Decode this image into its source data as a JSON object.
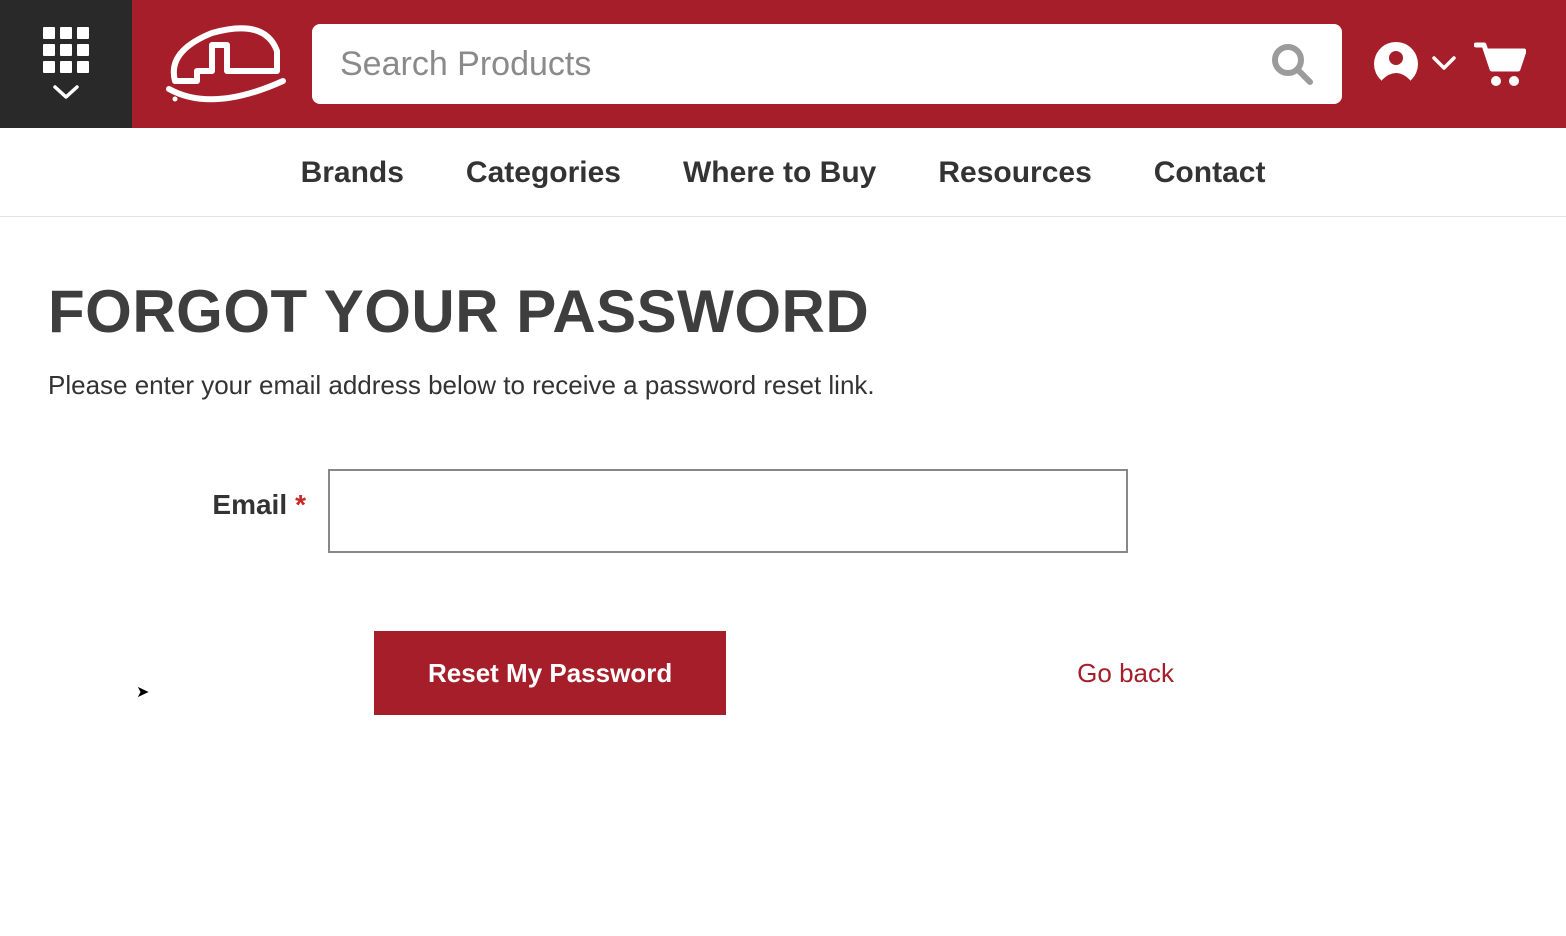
{
  "header": {
    "search_placeholder": "Search Products"
  },
  "nav": {
    "items": [
      "Brands",
      "Categories",
      "Where to Buy",
      "Resources",
      "Contact"
    ]
  },
  "page": {
    "title": "FORGOT YOUR PASSWORD",
    "subtitle": "Please enter your email address below to receive a password reset link.",
    "email_label": "Email",
    "required_mark": "*",
    "email_value": "",
    "reset_label": "Reset My Password",
    "goback_label": "Go back"
  }
}
